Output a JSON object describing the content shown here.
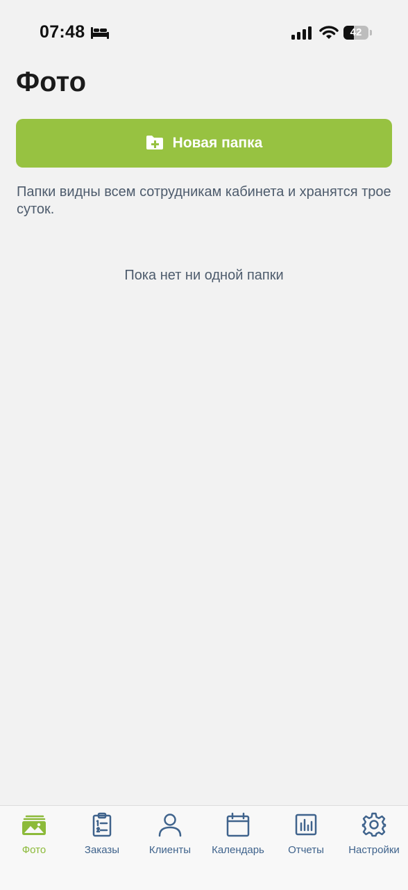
{
  "status_bar": {
    "time": "07:48",
    "battery_percent": "42",
    "battery_level": 0.42,
    "icons": [
      "bed-icon",
      "signal-icon",
      "wifi-icon",
      "battery-icon"
    ]
  },
  "page": {
    "title": "Фото",
    "new_folder_label": "Новая папка",
    "info_text": "Папки видны всем сотрудникам кабинета и хранятся трое суток.",
    "empty_text": "Пока нет ни одной папки"
  },
  "tabs": [
    {
      "label": "Фото",
      "icon": "photos-icon",
      "active": true
    },
    {
      "label": "Заказы",
      "icon": "orders-clipboard-icon",
      "active": false
    },
    {
      "label": "Клиенты",
      "icon": "clients-person-icon",
      "active": false
    },
    {
      "label": "Календарь",
      "icon": "calendar-icon",
      "active": false
    },
    {
      "label": "Отчеты",
      "icon": "reports-chart-icon",
      "active": false
    },
    {
      "label": "Настройки",
      "icon": "settings-gear-icon",
      "active": false
    }
  ],
  "colors": {
    "accent": "#97c241",
    "active_tab": "#8cba3a",
    "inactive_tab": "#3f638c",
    "background": "#f2f2f2",
    "secondary_text": "#4d5b6c"
  }
}
